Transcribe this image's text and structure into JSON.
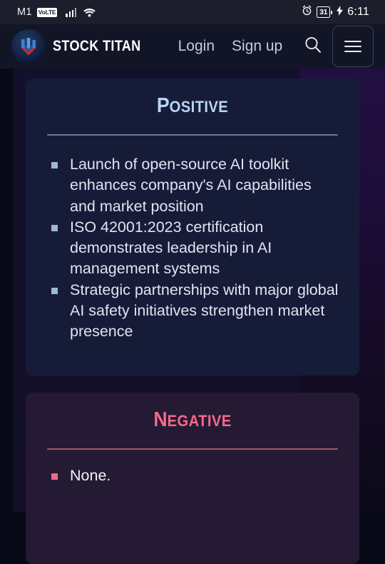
{
  "status_bar": {
    "carrier": "M1",
    "network_badge": "VoLTE",
    "signal_icon": "signal-bars-icon",
    "wifi_icon": "wifi-icon",
    "alarm_icon": "alarm-clock-icon",
    "battery_level": "31",
    "charging_icon": "charging-bolt-icon",
    "time": "6:11"
  },
  "header": {
    "logo_icon": "stock-titan-logo-icon",
    "brand": "STOCK TITAN",
    "nav": [
      {
        "label": "Login"
      },
      {
        "label": "Sign up"
      }
    ],
    "search_icon": "search-icon",
    "menu_icon": "hamburger-menu-icon"
  },
  "cards": [
    {
      "id": "positive",
      "title_cap": "P",
      "title_rest": "OSITIVE",
      "accent": "#b9d5f6",
      "divider_color": "#6a7899",
      "bullets": [
        "Launch of open-source AI toolkit enhances company's AI capabilities and market position",
        "ISO 42001:2023 certification demonstrates leadership in AI management systems",
        "Strategic partnerships with major global AI safety initiatives strengthen market presence"
      ]
    },
    {
      "id": "negative",
      "title_cap": "N",
      "title_rest": "EGATIVE",
      "accent": "#f4688c",
      "divider_color": "#a8546c",
      "bullets": [
        "None."
      ]
    }
  ]
}
